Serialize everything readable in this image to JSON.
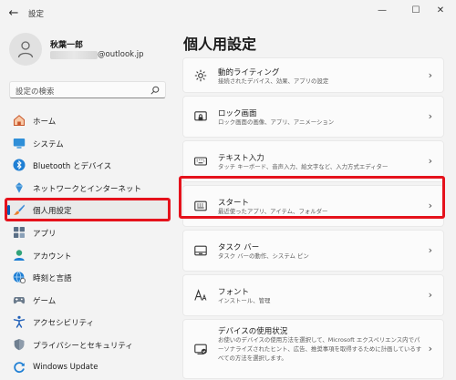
{
  "window": {
    "title": "設定",
    "back_glyph": "←",
    "min_glyph": "—",
    "max_glyph": "☐",
    "close_glyph": "✕"
  },
  "profile": {
    "name": "秋葉一郎",
    "email_domain": "@outlook.jp"
  },
  "search": {
    "placeholder": "設定の検索"
  },
  "nav": {
    "items": [
      {
        "label": "ホーム",
        "icon": "home-icon"
      },
      {
        "label": "システム",
        "icon": "system-icon"
      },
      {
        "label": "Bluetooth とデバイス",
        "icon": "bluetooth-icon"
      },
      {
        "label": "ネットワークとインターネット",
        "icon": "network-icon"
      },
      {
        "label": "個人用設定",
        "icon": "brush-icon",
        "selected": true
      },
      {
        "label": "アプリ",
        "icon": "apps-icon"
      },
      {
        "label": "アカウント",
        "icon": "account-icon"
      },
      {
        "label": "時刻と言語",
        "icon": "time-language-icon"
      },
      {
        "label": "ゲーム",
        "icon": "gaming-icon"
      },
      {
        "label": "アクセシビリティ",
        "icon": "accessibility-icon"
      },
      {
        "label": "プライバシーとセキュリティ",
        "icon": "shield-icon"
      },
      {
        "label": "Windows Update",
        "icon": "windows-update-icon"
      }
    ]
  },
  "page": {
    "title": "個人用設定"
  },
  "cards": [
    {
      "title": "動的ライティング",
      "desc": "接続されたデバイス、効果、アプリの設定",
      "icon": "dynamic-lighting-icon"
    },
    {
      "title": "ロック画面",
      "desc": "ロック画面の画像、アプリ、アニメーション",
      "icon": "lock-screen-icon"
    },
    {
      "title": "テキスト入力",
      "desc": "タッチ キーボード、音声入力、絵文字など、入力方式エディター",
      "icon": "keyboard-icon"
    },
    {
      "title": "スタート",
      "desc": "最近使ったアプリ、アイテム、フォルダー",
      "icon": "start-icon"
    },
    {
      "title": "タスク バー",
      "desc": "タスク バーの動作、システム ピン",
      "icon": "taskbar-icon"
    },
    {
      "title": "フォント",
      "desc": "インストール、管理",
      "icon": "fonts-icon"
    },
    {
      "title": "デバイスの使用状況",
      "desc": "お使いのデバイスの使用方法を選択して、Microsoft エクスペリエンス内でパーソナライズされたヒント、広告、推奨事項を取得するために計画しているすべての方法を選択します。",
      "icon": "device-usage-icon"
    }
  ],
  "colors": {
    "accent": "#005fb8",
    "highlight": "#e5121c"
  }
}
